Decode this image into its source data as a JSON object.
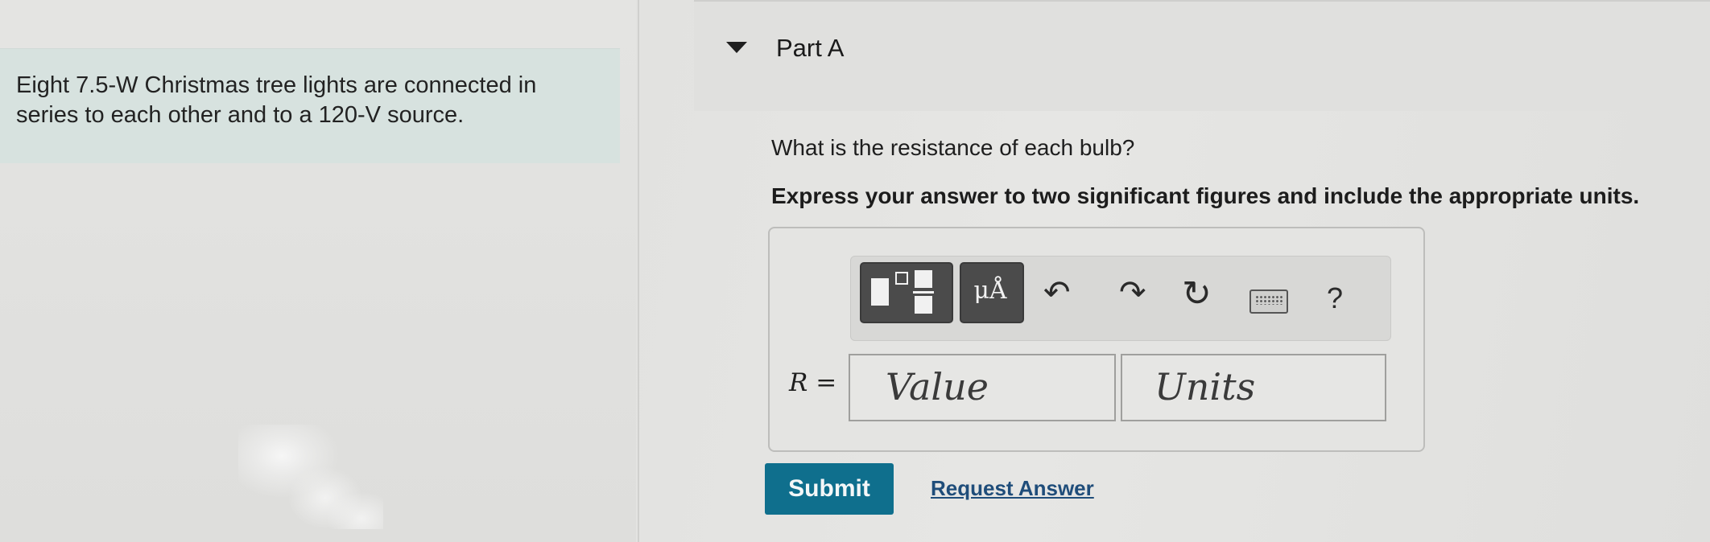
{
  "problem": {
    "line1": "Eight 7.5-W Christmas tree lights are connected in",
    "line2": "series to each other and to a 120-V source."
  },
  "part": {
    "title": "Part A",
    "question": "What is the resistance of each bulb?",
    "instruction": "Express your answer to two significant figures and include the appropriate units."
  },
  "toolbar": {
    "units_symbol": "μÅ",
    "icons": [
      "templates-icon",
      "units-icon",
      "undo-icon",
      "redo-icon",
      "reset-icon",
      "keyboard-icon",
      "help-icon"
    ],
    "help_label": "?"
  },
  "answer": {
    "variable": "R",
    "equals": " =",
    "value_placeholder": "Value",
    "units_placeholder": "Units"
  },
  "actions": {
    "submit_label": "Submit",
    "request_label": "Request Answer"
  },
  "colors": {
    "submit": "#0f6f8d",
    "problem_bg": "#d7e2df",
    "link": "#1f4d7a"
  }
}
